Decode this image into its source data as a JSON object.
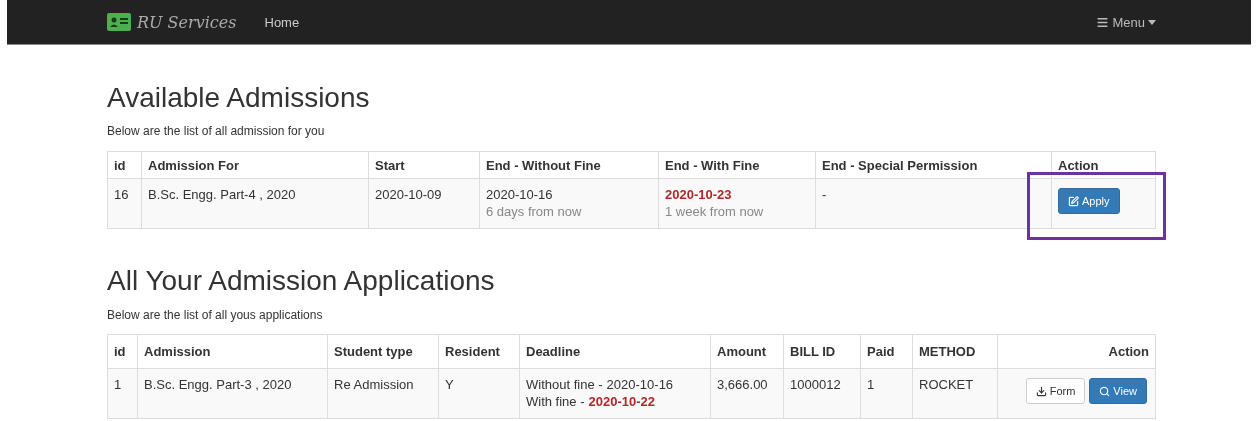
{
  "navbar": {
    "brand": "RU Services",
    "links": [
      {
        "label": "Home"
      }
    ],
    "menu": "Menu"
  },
  "sections": [
    {
      "title": "Available Admissions",
      "subtitle": "Below are the list of all admission for you",
      "columns": [
        "id",
        "Admission For",
        "Start",
        "End - Without Fine",
        "End - With Fine",
        "End - Special Permission",
        "Action"
      ],
      "rows": [
        {
          "cells": [
            {
              "kind": "text",
              "text": "16"
            },
            {
              "kind": "text",
              "text": "B.Sc. Engg. Part-4 , 2020"
            },
            {
              "kind": "text",
              "text": "2020-10-09"
            },
            {
              "kind": "text",
              "text": "2020-10-16",
              "note": "6 days from now",
              "late": false
            },
            {
              "kind": "text",
              "text": "2020-10-23",
              "note": "1 week from now",
              "late": true
            },
            {
              "kind": "text",
              "text": "-"
            },
            {
              "kind": "actions",
              "highlighted": true,
              "buttons": [
                {
                  "kind": "apply",
                  "label": "Apply"
                }
              ]
            }
          ]
        }
      ]
    },
    {
      "title": "All Your Admission Applications",
      "subtitle": "Below are the list of all yous applications",
      "columns": [
        "id",
        "Admission",
        "Student type",
        "Resident",
        "Deadline",
        "Amount",
        "BILL ID",
        "Paid",
        "METHOD",
        "Action"
      ],
      "rows": [
        {
          "cells": [
            {
              "kind": "text",
              "text": "1"
            },
            {
              "kind": "text",
              "text": "B.Sc. Engg. Part-3 , 2020"
            },
            {
              "kind": "text",
              "text": "Re Admission"
            },
            {
              "kind": "text",
              "text": "Y"
            },
            {
              "kind": "dates",
              "lines": [
                {
                  "label": "Without fine -",
                  "date": "2020-10-16",
                  "late": false
                },
                {
                  "label": "With fine -",
                  "date": "2020-10-22",
                  "late": true
                }
              ]
            },
            {
              "kind": "text",
              "text": "3,666.00"
            },
            {
              "kind": "text",
              "text": "1000012"
            },
            {
              "kind": "text",
              "text": "1"
            },
            {
              "kind": "text",
              "text": "ROCKET"
            },
            {
              "kind": "actions",
              "highlighted": false,
              "buttons": [
                {
                  "kind": "form",
                  "label": "Form"
                },
                {
                  "kind": "view",
                  "label": "View"
                }
              ]
            }
          ]
        }
      ]
    }
  ]
}
